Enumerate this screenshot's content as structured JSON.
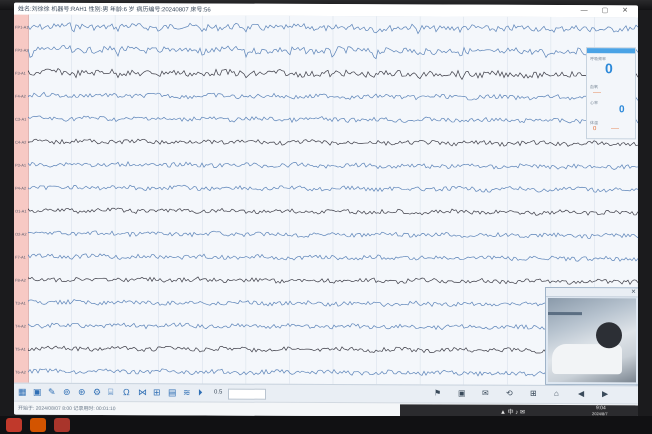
{
  "window": {
    "title": "姓名:刘徐徐 机器号:RAH1 性别:男 年龄:6 岁 病历编号:20240807 床号:56",
    "controls": "— ▢ ✕"
  },
  "channels": [
    "FP1-A1",
    "FP2-A2",
    "F3-A1",
    "F4-A2",
    "C3-A1",
    "C4-A2",
    "P3-A1",
    "P4-A2",
    "O1-A1",
    "O2-A2",
    "F7-A1",
    "F8-A2",
    "T3-A1",
    "T4-A2",
    "T5-A1",
    "T6-A2"
  ],
  "time_labels": [
    "09:04:24",
    "09:04:25",
    "09:04:26",
    "09:04:27",
    "09:04:28",
    "09:04:12",
    "09:04:13",
    "09:04:14",
    "09:04:15",
    "09:04:16",
    "09:04:17",
    "09:04:18",
    "09:04:19",
    "09:04:20"
  ],
  "side_panel": {
    "label1": "呼吸频率",
    "value1": "0",
    "label2": "血氧",
    "value2": "----",
    "label3": "心率",
    "value3": "0",
    "label4": "体温",
    "value4a": "0",
    "value4b": "----"
  },
  "video": {
    "close": "✕"
  },
  "toolbar": {
    "icons": [
      "▦",
      "▣",
      "✎",
      "⊚",
      "⊛",
      "⚙",
      "⌸",
      "Ω",
      "⋈",
      "⊞",
      "▤",
      "≋",
      "⏵"
    ],
    "zoom": "0.5",
    "right_icons": [
      "⚑",
      "▣",
      "✉",
      "⟲",
      "⊞",
      "⌂",
      "◀",
      "▶"
    ]
  },
  "status": {
    "text": "开始于: 2024/08/07 8:00 记录用时: 00:01:10"
  },
  "taskbar": {
    "icons": "▲ 中 ♪ ✉",
    "time": "9:04",
    "date": "2024/8/7"
  },
  "colors": {
    "trace_blue": "#5b83b8",
    "trace_dark": "#3c3c46",
    "channel_bg": "#f7c9c4",
    "accent": "#2c89d9"
  }
}
